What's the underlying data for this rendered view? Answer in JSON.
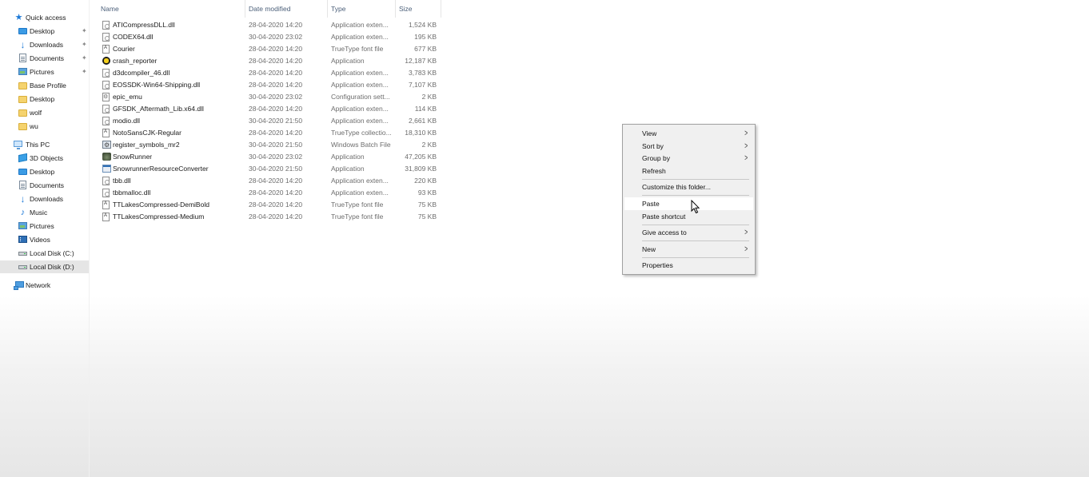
{
  "sidebar": {
    "items": [
      {
        "label": "Quick access",
        "icon": "star-icon"
      },
      {
        "label": "Desktop",
        "icon": "desktop-icon",
        "pinned": true
      },
      {
        "label": "Downloads",
        "icon": "download-icon",
        "pinned": true
      },
      {
        "label": "Documents",
        "icon": "documents-icon",
        "pinned": true
      },
      {
        "label": "Pictures",
        "icon": "pictures-icon",
        "pinned": true
      },
      {
        "label": "Base Profile",
        "icon": "folder-icon"
      },
      {
        "label": "Desktop",
        "icon": "folder-icon"
      },
      {
        "label": "wolf",
        "icon": "folder-icon"
      },
      {
        "label": "wu",
        "icon": "folder-icon"
      },
      {
        "label": "This PC",
        "icon": "computer-icon"
      },
      {
        "label": "3D Objects",
        "icon": "3d-objects-icon"
      },
      {
        "label": "Desktop",
        "icon": "desktop-icon"
      },
      {
        "label": "Documents",
        "icon": "documents-icon"
      },
      {
        "label": "Downloads",
        "icon": "download-icon"
      },
      {
        "label": "Music",
        "icon": "music-icon"
      },
      {
        "label": "Pictures",
        "icon": "pictures-icon"
      },
      {
        "label": "Videos",
        "icon": "videos-icon"
      },
      {
        "label": "Local Disk (C:)",
        "icon": "drive-icon"
      },
      {
        "label": "Local Disk (D:)",
        "icon": "drive-icon",
        "selected": true
      },
      {
        "label": "Network",
        "icon": "network-icon"
      }
    ]
  },
  "columns": {
    "name": "Name",
    "date": "Date modified",
    "type": "Type",
    "size": "Size"
  },
  "files": [
    {
      "name": "ATICompressDLL.dll",
      "date": "28-04-2020 14:20",
      "type": "Application exten...",
      "size": "1,524 KB",
      "icon": "dll-file-icon"
    },
    {
      "name": "CODEX64.dll",
      "date": "30-04-2020 23:02",
      "type": "Application exten...",
      "size": "195 KB",
      "icon": "dll-file-icon"
    },
    {
      "name": "Courier",
      "date": "28-04-2020 14:20",
      "type": "TrueType font file",
      "size": "677 KB",
      "icon": "font-file-icon"
    },
    {
      "name": "crash_reporter",
      "date": "28-04-2020 14:20",
      "type": "Application",
      "size": "12,187 KB",
      "icon": "crash-reporter-icon"
    },
    {
      "name": "d3dcompiler_46.dll",
      "date": "28-04-2020 14:20",
      "type": "Application exten...",
      "size": "3,783 KB",
      "icon": "dll-file-icon"
    },
    {
      "name": "EOSSDK-Win64-Shipping.dll",
      "date": "28-04-2020 14:20",
      "type": "Application exten...",
      "size": "7,107 KB",
      "icon": "dll-file-icon"
    },
    {
      "name": "epic_emu",
      "date": "30-04-2020 23:02",
      "type": "Configuration sett...",
      "size": "2 KB",
      "icon": "config-file-icon"
    },
    {
      "name": "GFSDK_Aftermath_Lib.x64.dll",
      "date": "28-04-2020 14:20",
      "type": "Application exten...",
      "size": "114 KB",
      "icon": "dll-file-icon"
    },
    {
      "name": "modio.dll",
      "date": "30-04-2020 21:50",
      "type": "Application exten...",
      "size": "2,661 KB",
      "icon": "dll-file-icon"
    },
    {
      "name": "NotoSansCJK-Regular",
      "date": "28-04-2020 14:20",
      "type": "TrueType collectio...",
      "size": "18,310 KB",
      "icon": "font-file-icon"
    },
    {
      "name": "register_symbols_mr2",
      "date": "30-04-2020 21:50",
      "type": "Windows Batch File",
      "size": "2 KB",
      "icon": "batch-file-icon"
    },
    {
      "name": "SnowRunner",
      "date": "30-04-2020 23:02",
      "type": "Application",
      "size": "47,205 KB",
      "icon": "snowrunner-icon"
    },
    {
      "name": "SnowrunnerResourceConverter",
      "date": "30-04-2020 21:50",
      "type": "Application",
      "size": "31,809 KB",
      "icon": "application-icon"
    },
    {
      "name": "tbb.dll",
      "date": "28-04-2020 14:20",
      "type": "Application exten...",
      "size": "220 KB",
      "icon": "dll-file-icon"
    },
    {
      "name": "tbbmalloc.dll",
      "date": "28-04-2020 14:20",
      "type": "Application exten...",
      "size": "93 KB",
      "icon": "dll-file-icon"
    },
    {
      "name": "TTLakesCompressed-DemiBold",
      "date": "28-04-2020 14:20",
      "type": "TrueType font file",
      "size": "75 KB",
      "icon": "font-file-icon"
    },
    {
      "name": "TTLakesCompressed-Medium",
      "date": "28-04-2020 14:20",
      "type": "TrueType font file",
      "size": "75 KB",
      "icon": "font-file-icon"
    }
  ],
  "context_menu": {
    "items": [
      {
        "label": "View",
        "submenu": true
      },
      {
        "label": "Sort by",
        "submenu": true
      },
      {
        "label": "Group by",
        "submenu": true
      },
      {
        "label": "Refresh",
        "submenu": false
      },
      {
        "label": "Customize this folder...",
        "submenu": false
      },
      {
        "label": "Paste",
        "submenu": false,
        "hover": true
      },
      {
        "label": "Paste shortcut",
        "submenu": false
      },
      {
        "label": "Give access to",
        "submenu": true
      },
      {
        "label": "New",
        "submenu": true
      },
      {
        "label": "Properties",
        "submenu": false
      }
    ]
  }
}
